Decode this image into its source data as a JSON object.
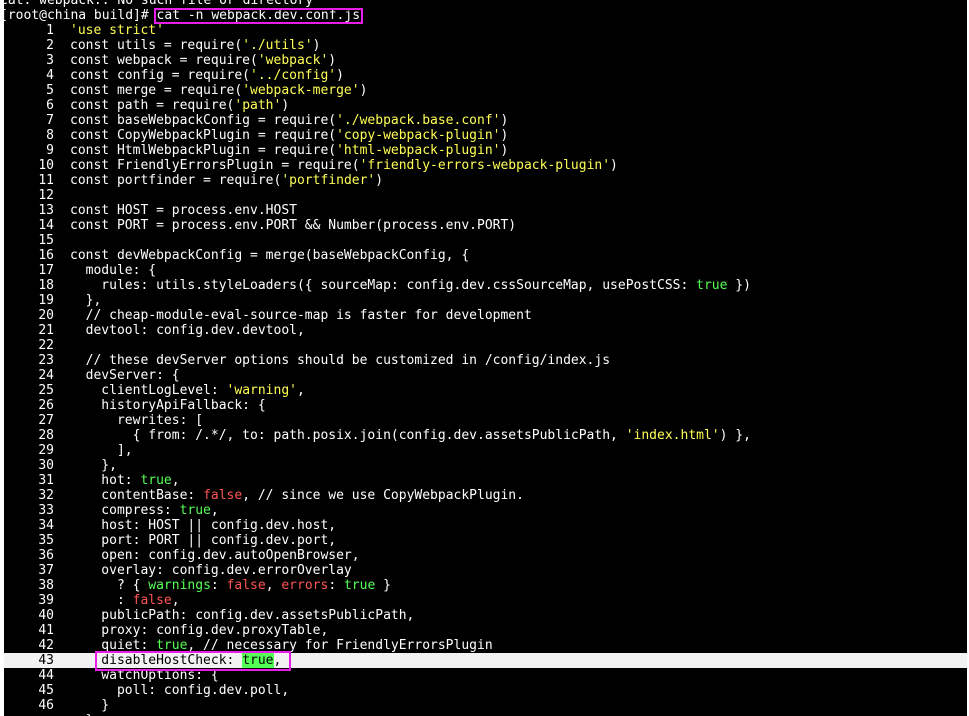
{
  "terminal": {
    "prev_output": "cat: webpack:: No such file or directory",
    "prompt": "[root@china build]# ",
    "command": "cat -n webpack.dev.conf.js",
    "colors": {
      "background": "#000000",
      "text": "#ffffff",
      "string": "#ffff55",
      "keyword_true": "#55ff55",
      "keyword_false": "#ff5555",
      "highlight_row": "#f2f2f2",
      "annotation_box": "#e81ee8"
    },
    "code_lines": [
      {
        "n": "1",
        "segs": [
          [
            "'use strict'",
            "s"
          ]
        ]
      },
      {
        "n": "2",
        "segs": [
          [
            "const utils = require(",
            ""
          ],
          [
            "'./utils'",
            "s"
          ],
          [
            ")",
            ""
          ]
        ]
      },
      {
        "n": "3",
        "segs": [
          [
            "const webpack = require(",
            ""
          ],
          [
            "'webpack'",
            "s"
          ],
          [
            ")",
            ""
          ]
        ]
      },
      {
        "n": "4",
        "segs": [
          [
            "const config = require(",
            ""
          ],
          [
            "'../config'",
            "s"
          ],
          [
            ")",
            ""
          ]
        ]
      },
      {
        "n": "5",
        "segs": [
          [
            "const merge = require(",
            ""
          ],
          [
            "'webpack-merge'",
            "s"
          ],
          [
            ")",
            ""
          ]
        ]
      },
      {
        "n": "6",
        "segs": [
          [
            "const path = require(",
            ""
          ],
          [
            "'path'",
            "s"
          ],
          [
            ")",
            ""
          ]
        ]
      },
      {
        "n": "7",
        "segs": [
          [
            "const baseWebpackConfig = require(",
            ""
          ],
          [
            "'./webpack.base.conf'",
            "s"
          ],
          [
            ")",
            ""
          ]
        ]
      },
      {
        "n": "8",
        "segs": [
          [
            "const CopyWebpackPlugin = require(",
            ""
          ],
          [
            "'copy-webpack-plugin'",
            "s"
          ],
          [
            ")",
            ""
          ]
        ]
      },
      {
        "n": "9",
        "segs": [
          [
            "const HtmlWebpackPlugin = require(",
            ""
          ],
          [
            "'html-webpack-plugin'",
            "s"
          ],
          [
            ")",
            ""
          ]
        ]
      },
      {
        "n": "10",
        "segs": [
          [
            "const FriendlyErrorsPlugin = require(",
            ""
          ],
          [
            "'friendly-errors-webpack-plugin'",
            "s"
          ],
          [
            ")",
            ""
          ]
        ]
      },
      {
        "n": "11",
        "segs": [
          [
            "const portfinder = require(",
            ""
          ],
          [
            "'portfinder'",
            "s"
          ],
          [
            ")",
            ""
          ]
        ]
      },
      {
        "n": "12",
        "segs": []
      },
      {
        "n": "13",
        "segs": [
          [
            "const HOST = process.env.HOST",
            ""
          ]
        ]
      },
      {
        "n": "14",
        "segs": [
          [
            "const PORT = process.env.PORT && Number(process.env.PORT)",
            ""
          ]
        ]
      },
      {
        "n": "15",
        "segs": []
      },
      {
        "n": "16",
        "segs": [
          [
            "const devWebpackConfig = merge(baseWebpackConfig, {",
            ""
          ]
        ]
      },
      {
        "n": "17",
        "segs": [
          [
            "  module: {",
            ""
          ]
        ]
      },
      {
        "n": "18",
        "segs": [
          [
            "    rules: utils.styleLoaders({ sourceMap: config.dev.cssSourceMap, usePostCSS: ",
            ""
          ],
          [
            "true",
            "t"
          ],
          [
            " })",
            ""
          ]
        ]
      },
      {
        "n": "19",
        "segs": [
          [
            "  },",
            ""
          ]
        ]
      },
      {
        "n": "20",
        "segs": [
          [
            "  // cheap-module-eval-source-map is faster for development",
            ""
          ]
        ]
      },
      {
        "n": "21",
        "segs": [
          [
            "  devtool: config.dev.devtool,",
            ""
          ]
        ]
      },
      {
        "n": "22",
        "segs": []
      },
      {
        "n": "23",
        "segs": [
          [
            "  // these devServer options should be customized in /config/index.js",
            ""
          ]
        ]
      },
      {
        "n": "24",
        "segs": [
          [
            "  devServer: {",
            ""
          ]
        ]
      },
      {
        "n": "25",
        "segs": [
          [
            "    clientLogLevel: ",
            ""
          ],
          [
            "'warning'",
            "s"
          ],
          [
            ",",
            ""
          ]
        ]
      },
      {
        "n": "26",
        "segs": [
          [
            "    historyApiFallback: {",
            ""
          ]
        ]
      },
      {
        "n": "27",
        "segs": [
          [
            "      rewrites: [",
            ""
          ]
        ]
      },
      {
        "n": "28",
        "segs": [
          [
            "        { from: /.*/, to: path.posix.join(config.dev.assetsPublicPath, ",
            ""
          ],
          [
            "'index.html'",
            "s"
          ],
          [
            ") },",
            ""
          ]
        ]
      },
      {
        "n": "29",
        "segs": [
          [
            "      ],",
            ""
          ]
        ]
      },
      {
        "n": "30",
        "segs": [
          [
            "    },",
            ""
          ]
        ]
      },
      {
        "n": "31",
        "segs": [
          [
            "    hot: ",
            ""
          ],
          [
            "true",
            "t"
          ],
          [
            ",",
            ""
          ]
        ]
      },
      {
        "n": "32",
        "segs": [
          [
            "    contentBase: ",
            ""
          ],
          [
            "false",
            "f"
          ],
          [
            ", // since we use CopyWebpackPlugin.",
            ""
          ]
        ]
      },
      {
        "n": "33",
        "segs": [
          [
            "    compress: ",
            ""
          ],
          [
            "true",
            "t"
          ],
          [
            ",",
            ""
          ]
        ]
      },
      {
        "n": "34",
        "segs": [
          [
            "    host: HOST || config.dev.host,",
            ""
          ]
        ]
      },
      {
        "n": "35",
        "segs": [
          [
            "    port: PORT || config.dev.port,",
            ""
          ]
        ]
      },
      {
        "n": "36",
        "segs": [
          [
            "    open: config.dev.autoOpenBrowser,",
            ""
          ]
        ]
      },
      {
        "n": "37",
        "segs": [
          [
            "    overlay: config.dev.errorOverlay",
            ""
          ]
        ]
      },
      {
        "n": "38",
        "segs": [
          [
            "      ? { ",
            ""
          ],
          [
            "warnings",
            "t"
          ],
          [
            ": ",
            ""
          ],
          [
            "false",
            "f"
          ],
          [
            ", ",
            ""
          ],
          [
            "errors",
            "f"
          ],
          [
            ": ",
            ""
          ],
          [
            "true",
            "t"
          ],
          [
            " }",
            ""
          ]
        ]
      },
      {
        "n": "39",
        "segs": [
          [
            "      : ",
            ""
          ],
          [
            "false",
            "f"
          ],
          [
            ",",
            ""
          ]
        ]
      },
      {
        "n": "40",
        "segs": [
          [
            "    publicPath: config.dev.assetsPublicPath,",
            ""
          ]
        ]
      },
      {
        "n": "41",
        "segs": [
          [
            "    proxy: config.dev.proxyTable,",
            ""
          ]
        ]
      },
      {
        "n": "42",
        "segs": [
          [
            "    quiet: ",
            ""
          ],
          [
            "true",
            "t"
          ],
          [
            ", // necessary for FriendlyErrorsPlugin",
            ""
          ]
        ]
      },
      {
        "n": "43",
        "segs": [
          [
            "    disableHostCheck: ",
            ""
          ],
          [
            "true",
            "tb"
          ],
          [
            ",",
            ""
          ]
        ],
        "highlight": true
      },
      {
        "n": "44",
        "segs": [
          [
            "    watchOptions: {",
            ""
          ]
        ]
      },
      {
        "n": "45",
        "segs": [
          [
            "      poll: config.dev.poll,",
            ""
          ]
        ]
      },
      {
        "n": "46",
        "segs": [
          [
            "    }",
            ""
          ]
        ]
      },
      {
        "n": "",
        "segs": [
          [
            "  },",
            ""
          ]
        ]
      }
    ]
  }
}
